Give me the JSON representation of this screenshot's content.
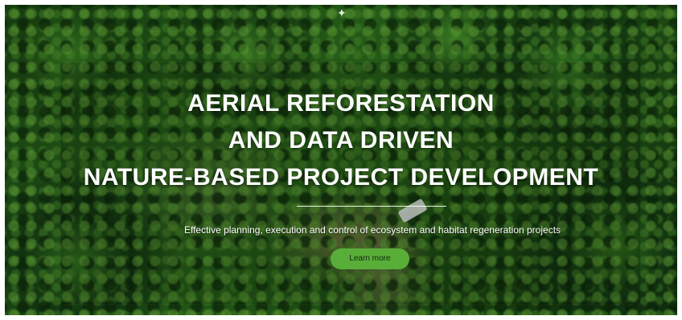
{
  "hero": {
    "headline_line1": "AERIAL REFORESTATION",
    "headline_line2": "AND DATA DRIVEN",
    "headline_line3": "NATURE-BASED PROJECT DEVELOPMENT",
    "subtitle": "Effective planning, execution and control of ecosystem and habitat regeneration projects",
    "cta_label": "Learn more",
    "cta_color": "#58ae39"
  },
  "background": {
    "description_icon": "aerial-forest-image"
  }
}
